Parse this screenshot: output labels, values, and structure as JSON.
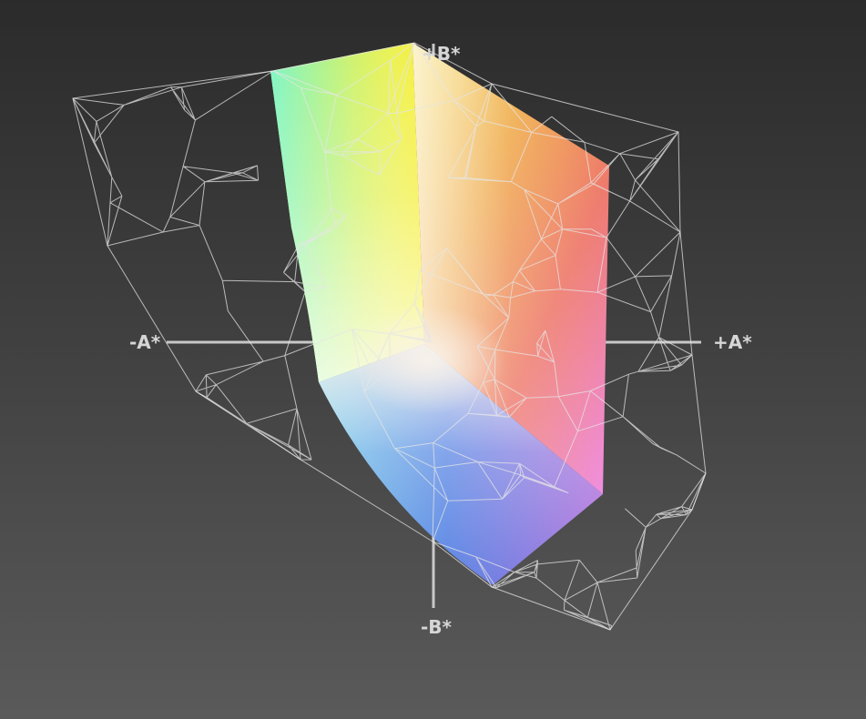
{
  "axes": {
    "plus_b": "+B*",
    "minus_b": "-B*",
    "plus_a": "+A*",
    "minus_a": "-A*"
  },
  "colors": {
    "background_top": "#2b2b2b",
    "background_bottom": "#5a5a5a",
    "axis": "#c8c8c8",
    "wireframe": "#e6e6e6",
    "yellow": "#f2f22a",
    "lime": "#a6ec1a",
    "orange": "#ea7d22",
    "red": "#ef5a5a",
    "magenta": "#f184f0",
    "violet": "#a472d8",
    "blue": "#4c70e8",
    "cyan": "#78f6d6",
    "white_point": "#f2ece6"
  }
}
